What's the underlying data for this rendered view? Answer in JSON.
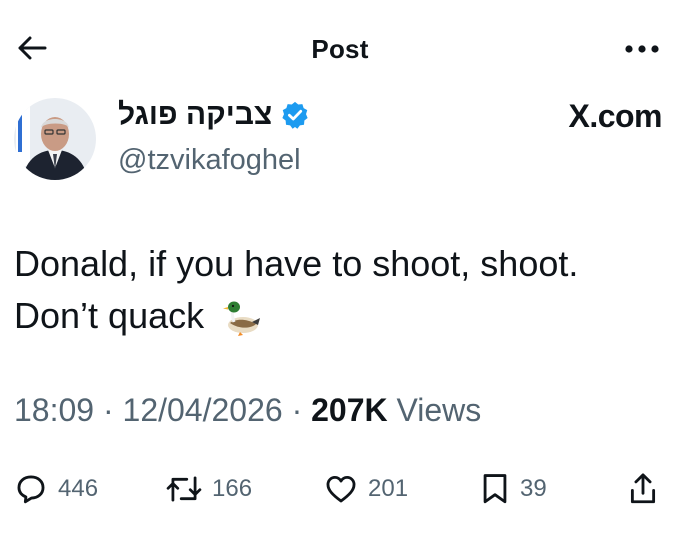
{
  "header": {
    "title": "Post",
    "back_icon": "arrow-left-icon",
    "more_icon": "more-horizontal-icon"
  },
  "author": {
    "display_name": "צביקה פוגל",
    "handle": "@tzvikafoghel",
    "verified": true,
    "verified_color": "#1d9bf0",
    "brand_label": "X.com"
  },
  "post": {
    "text_line1": "Donald, if you have to shoot, shoot.",
    "text_line2": "Don’t quack",
    "emoji": "duck-emoji"
  },
  "meta": {
    "time": "18:09",
    "separator": "·",
    "date": "12/04/2026",
    "views_count": "207K",
    "views_label": "Views"
  },
  "actions": {
    "replies": "446",
    "reposts": "166",
    "likes": "201",
    "bookmarks": "39"
  },
  "colors": {
    "text": "#0f1419",
    "secondary": "#536471",
    "accent": "#1d9bf0"
  }
}
